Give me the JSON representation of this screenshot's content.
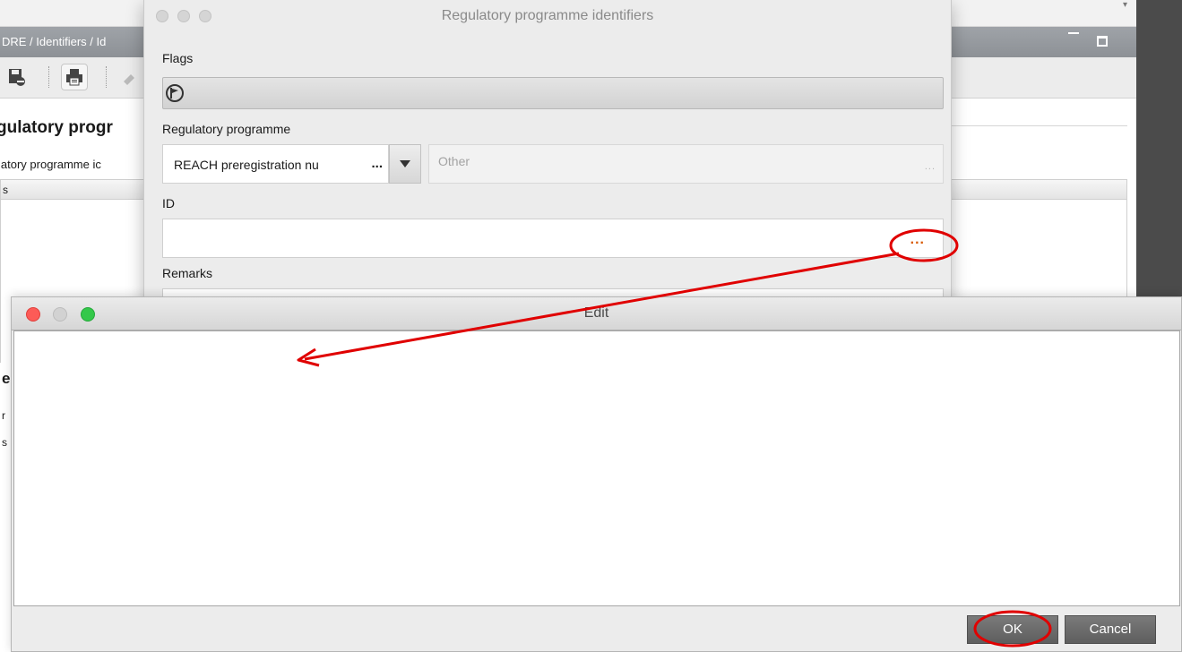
{
  "background_window": {
    "breadcrumb": "DRE / Identifiers / Id",
    "heading": "gulatory progr",
    "subheading": "latory programme ic",
    "table_header": "s",
    "partial_left_texts": [
      "e",
      "r",
      "s"
    ]
  },
  "regulatory_dialog": {
    "title": "Regulatory programme identifiers",
    "flags_label": "Flags",
    "regulatory_programme_label": "Regulatory programme",
    "regulatory_programme_value": "REACH preregistration nu",
    "select_more": "...",
    "other_placeholder": "Other",
    "other_more": "...",
    "id_label": "ID",
    "id_value": "",
    "id_more": "...",
    "remarks_label": "Remarks"
  },
  "edit_dialog": {
    "title": "Edit",
    "text_value": "",
    "ok_label": "OK",
    "cancel_label": "Cancel"
  },
  "colors": {
    "annotation": "#e00000",
    "ellipsis_highlight": "#d95a00",
    "close_button": "#fc5b57",
    "zoom_button": "#34c84a"
  }
}
